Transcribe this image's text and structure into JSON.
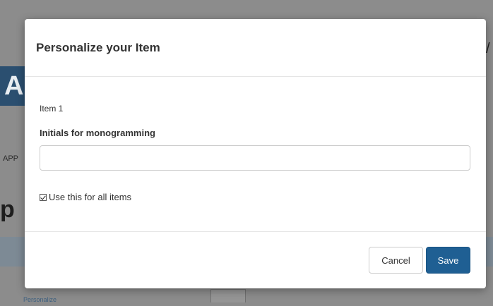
{
  "background": {
    "brand_fragment": "A",
    "app_label_fragment": "APP",
    "heading_fragment": "p",
    "right_edge_fragment": "/",
    "link_text": "Personalize"
  },
  "modal": {
    "title": "Personalize your Item",
    "item_label": "Item 1",
    "field_label": "Initials for monogramming",
    "initials_value": "",
    "apply_all_checked": true,
    "apply_all_label": "Use this for all items",
    "cancel_label": "Cancel",
    "save_label": "Save"
  },
  "colors": {
    "primary_button": "#1f5f93",
    "overlay": "#8c8c8c"
  }
}
